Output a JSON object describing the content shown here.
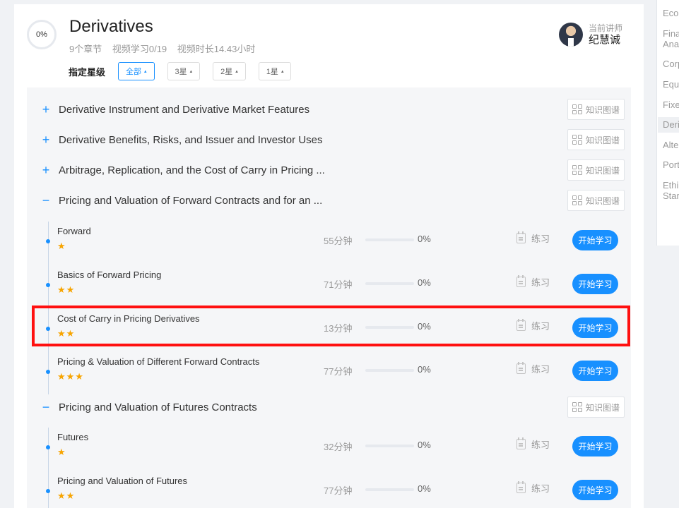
{
  "course": {
    "progress_label": "0%",
    "title": "Derivatives",
    "chapters": "9个章节",
    "videos": "视频学习0/19",
    "duration": "视频时长14.43小时"
  },
  "teacher": {
    "label": "当前讲师",
    "name": "纪慧诚"
  },
  "filter": {
    "label": "指定星级",
    "options": [
      {
        "label": "全部",
        "active": true
      },
      {
        "label": "3星",
        "active": false
      },
      {
        "label": "2星",
        "active": false
      },
      {
        "label": "1星",
        "active": false
      }
    ],
    "arrow": "▴"
  },
  "kg_label": "知识图谱",
  "practice_label": "练习",
  "start_label": "开始学习",
  "sections": [
    {
      "toggle": "+",
      "title": "Derivative Instrument and Derivative Market Features"
    },
    {
      "toggle": "+",
      "title": "Derivative Benefits, Risks, and Issuer and Investor Uses"
    },
    {
      "toggle": "+",
      "title": "Arbitrage, Replication, and the Cost of Carry in Pricing ..."
    },
    {
      "toggle": "−",
      "title": "Pricing and Valuation of Forward Contracts and for an ..."
    },
    {
      "toggle": "−",
      "title": "Pricing and Valuation of Futures Contracts"
    }
  ],
  "lessons": [
    {
      "title": "Forward",
      "stars": "★",
      "duration": "55分钟",
      "progress": 0,
      "pct": "0%"
    },
    {
      "title": "Basics of Forward Pricing",
      "stars": "★★",
      "duration": "71分钟",
      "progress": 0,
      "pct": "0%"
    },
    {
      "title": "Cost of Carry in Pricing Derivatives",
      "stars": "★★",
      "duration": "13分钟",
      "progress": 0,
      "pct": "0%"
    },
    {
      "title": "Pricing & Valuation of Different Forward Contracts",
      "stars": "★★★",
      "duration": "77分钟",
      "progress": 0,
      "pct": "0%"
    },
    {
      "title": "Futures",
      "stars": "★",
      "duration": "32分钟",
      "progress": 0,
      "pct": "0%"
    },
    {
      "title": "Pricing and Valuation of Futures",
      "stars": "★★",
      "duration": "77分钟",
      "progress": 0,
      "pct": "0%"
    }
  ],
  "side_nav": [
    {
      "label": "Econ",
      "active": false
    },
    {
      "label": "Fina",
      "active": false
    },
    {
      "label": "Ana",
      "active": false
    },
    {
      "label": "Corp",
      "active": false
    },
    {
      "label": "Equ",
      "active": false
    },
    {
      "label": "Fixe",
      "active": false
    },
    {
      "label": "Deri",
      "active": true
    },
    {
      "label": "Alte",
      "active": false
    },
    {
      "label": "Port",
      "active": false
    },
    {
      "label": "Ethi",
      "active": false
    },
    {
      "label": "Star",
      "active": false
    }
  ],
  "colors": {
    "accent": "#1890ff",
    "star": "#f7a400",
    "highlight": "#ff1010"
  }
}
